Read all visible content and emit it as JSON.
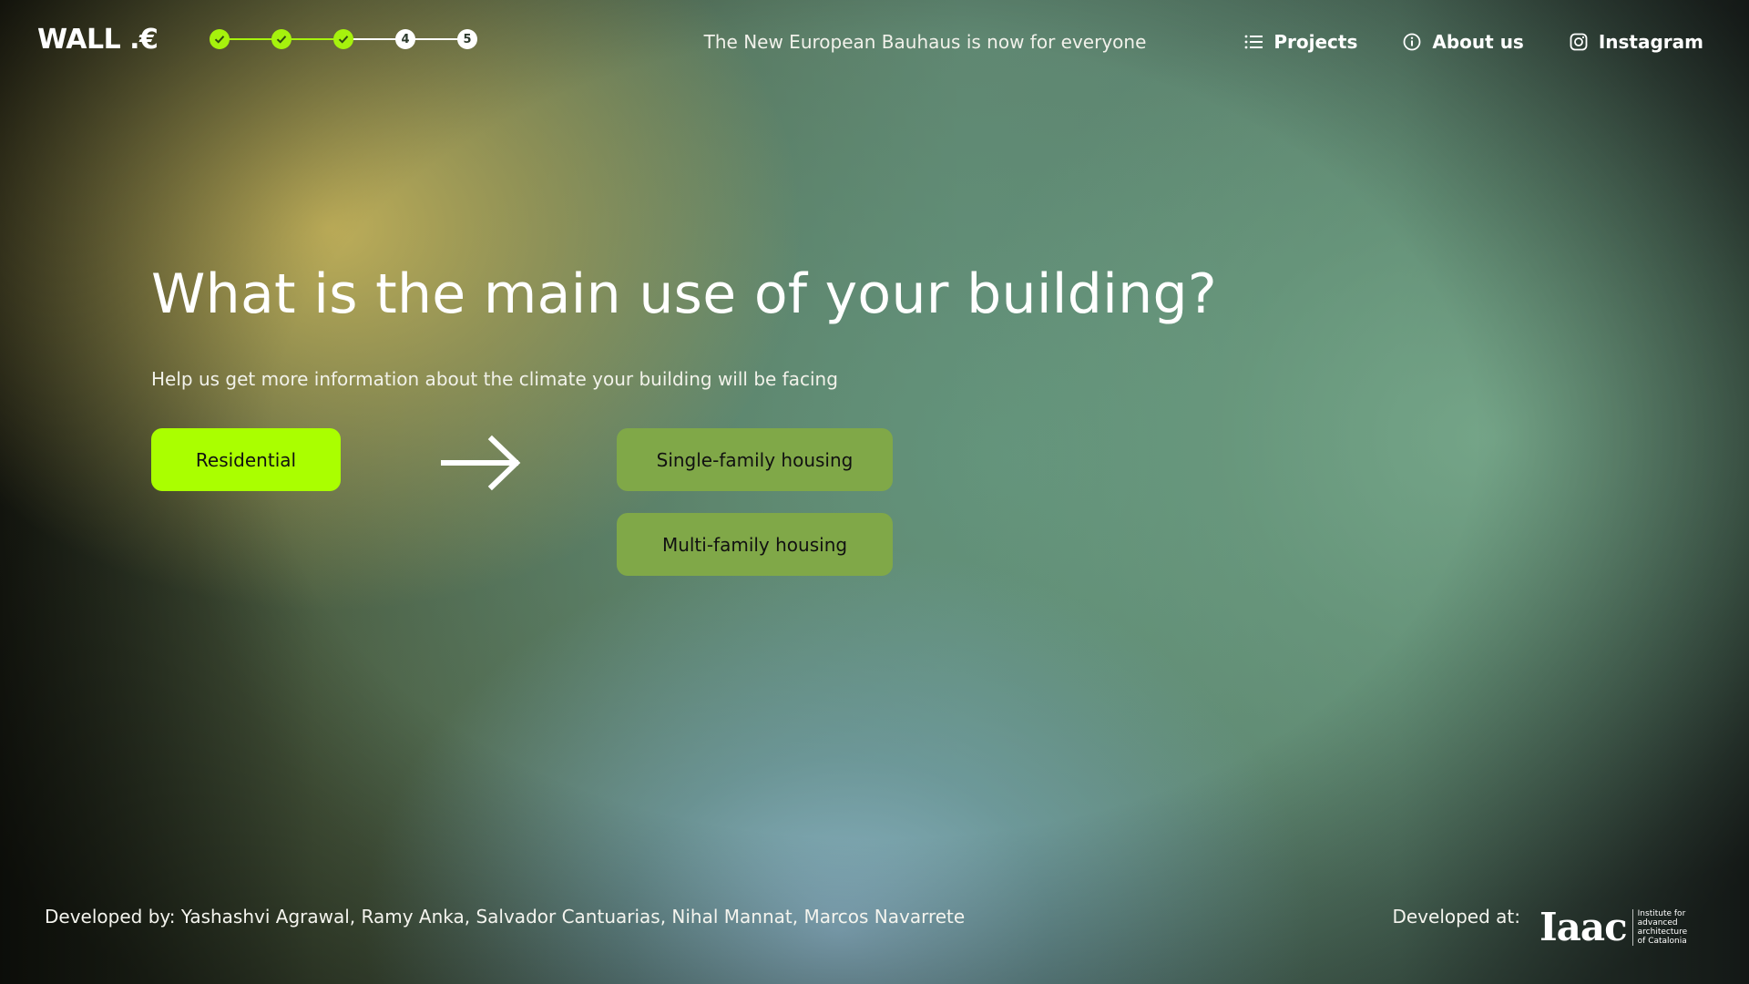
{
  "header": {
    "logo_text": "WALL .€",
    "steps": [
      {
        "label": "",
        "status": "done"
      },
      {
        "label": "",
        "status": "done"
      },
      {
        "label": "",
        "status": "done"
      },
      {
        "label": "4",
        "status": "todo"
      },
      {
        "label": "5",
        "status": "todo"
      }
    ],
    "current_step": 4,
    "tagline": "The New European Bauhaus is now for everyone",
    "nav": {
      "projects": {
        "label": "Projects",
        "icon": "list-icon"
      },
      "about": {
        "label": "About us",
        "icon": "info-icon"
      },
      "instagram": {
        "label": "Instagram",
        "icon": "instagram-icon"
      }
    }
  },
  "main": {
    "title": "What is the main use of your building?",
    "subtitle": "Help us get more information about the climate your building will be facing",
    "selected_option": "Residential",
    "arrow_icon": "arrow-right-icon",
    "sub_options": [
      "Single-family housing",
      "Multi-family housing"
    ]
  },
  "footer": {
    "credits": "Developed by: Yashashvi Agrawal,  Ramy Anka, Salvador Cantuarias, Nihal Mannat, Marcos Navarrete",
    "developed_at": "Developed at:",
    "iaac_logo": {
      "mark": "Iaac",
      "text_lines": [
        "Institute for",
        "advanced",
        "architecture",
        "of Catalonia"
      ]
    }
  },
  "colors": {
    "accent": "#aaff00",
    "step_done": "#a6f20d",
    "option_bg": "#80a848",
    "text": "#ffffff"
  }
}
